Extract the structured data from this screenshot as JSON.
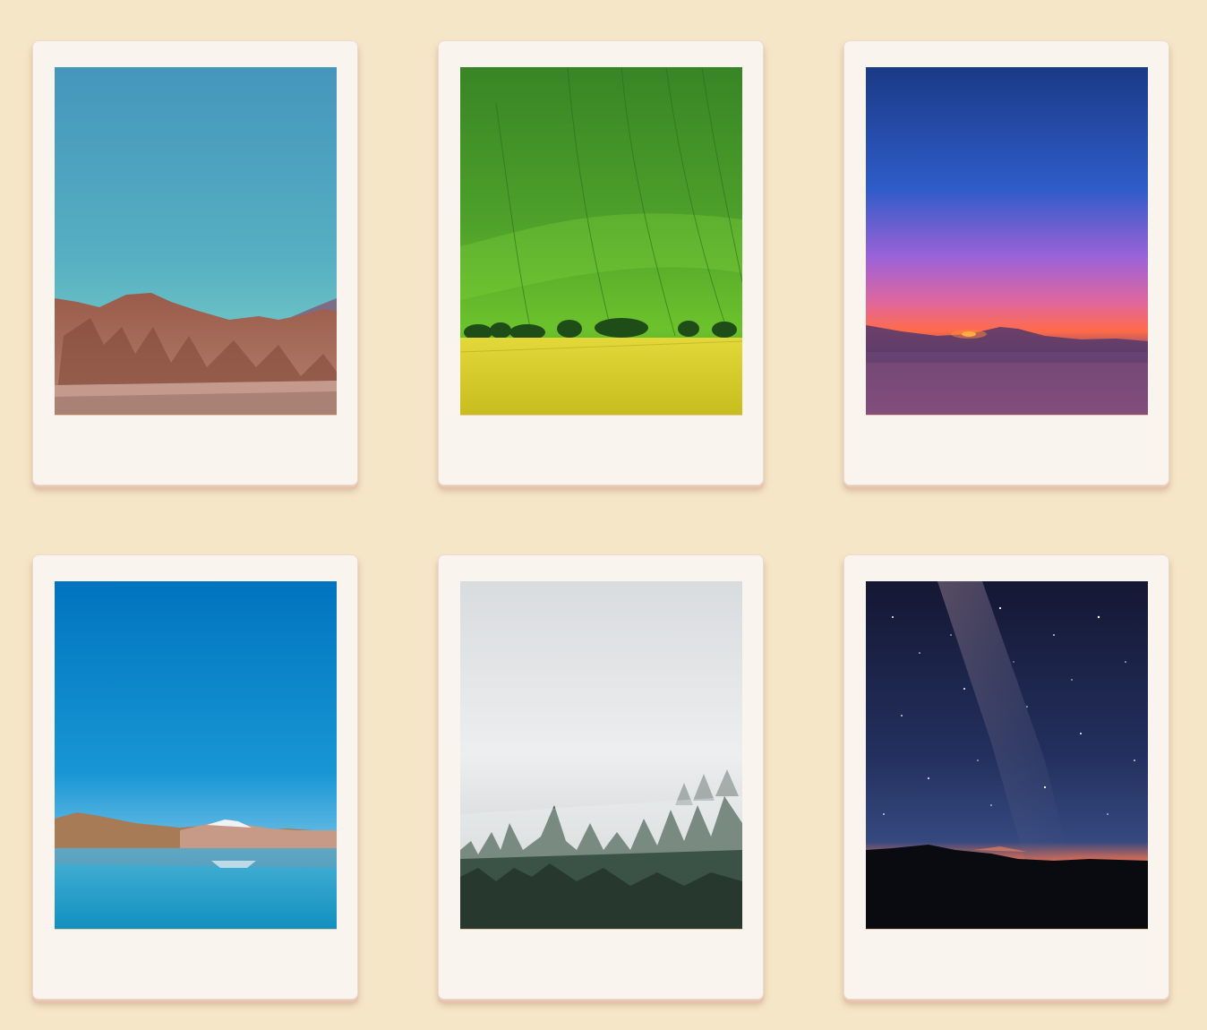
{
  "gallery": {
    "photos": [
      {
        "subject": "desert-mountains",
        "sky_top": "#4597bd",
        "sky_bottom": "#6bc4c8",
        "ground": "#9a5a45"
      },
      {
        "subject": "green-field",
        "top": "#3d8a2a",
        "mid": "#5fb82a",
        "ground": "#d8d02a"
      },
      {
        "subject": "sunset-horizon",
        "top": "#1c3a86",
        "mid": "#b15ad0",
        "glow": "#ff6a3a"
      },
      {
        "subject": "mountain-lake",
        "sky_top": "#0078c2",
        "sky_bottom": "#4fb0e0",
        "water": "#1f9ac6"
      },
      {
        "subject": "misty-forest",
        "sky": "#e7e9ea",
        "trees": "#2f4539"
      },
      {
        "subject": "milky-way-night",
        "top": "#121632",
        "mid": "#2b3a6e",
        "horizon": "#e8604a"
      }
    ]
  }
}
